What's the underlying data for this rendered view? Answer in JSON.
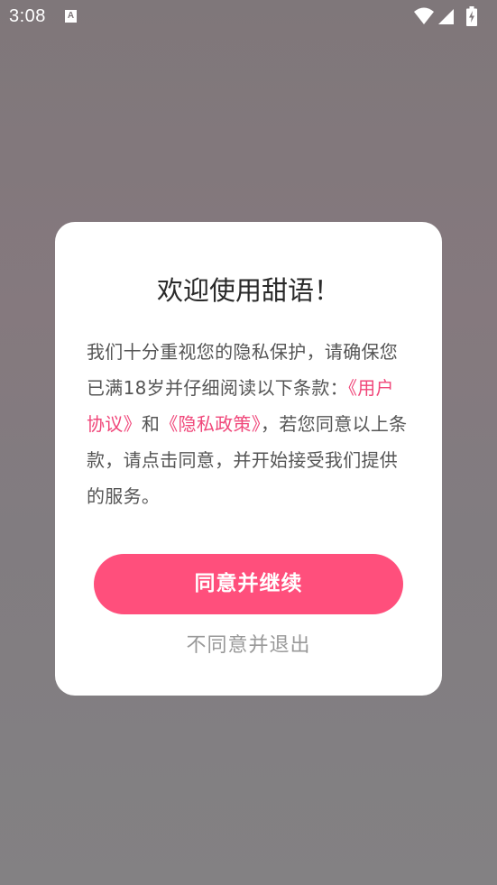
{
  "status_bar": {
    "time": "3:08",
    "notification_badge": "A"
  },
  "dialog": {
    "title": "欢迎使用甜语！",
    "body": {
      "part1": "我们十分重视您的隐私保护，请确保您已满18岁并仔细阅读以下条款：",
      "user_agreement_link": "《用户协议》",
      "conjunction": "和",
      "privacy_policy_link": "《隐私政策》",
      "part2": "，若您同意以上条款，请点击同意，并开始接受我们提供的服务。"
    },
    "agree_label": "同意并继续",
    "disagree_label": "不同意并退出"
  },
  "colors": {
    "accent": "#ff4f7c",
    "link": "#f0477a",
    "body_text": "#555555",
    "secondary_text": "#999999"
  }
}
